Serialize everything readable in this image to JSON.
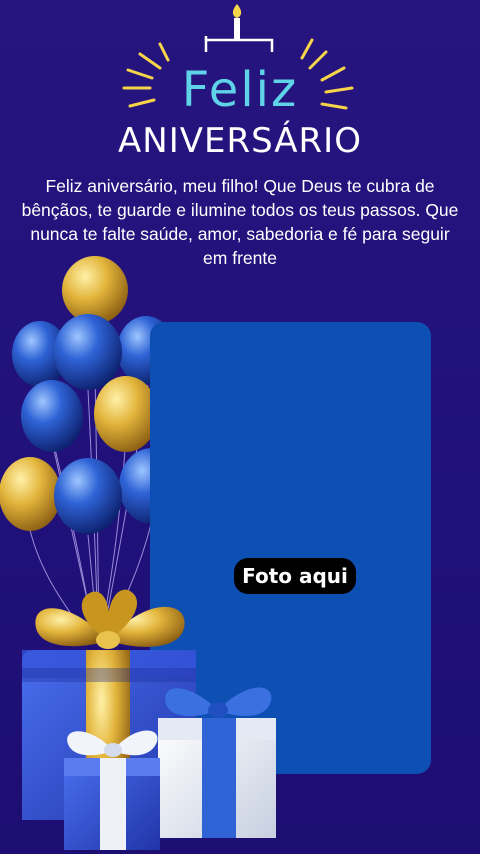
{
  "title": {
    "line1": "Feliz",
    "line2": "ANIVERSÁRIO"
  },
  "message": "Feliz aniversário, meu filho! Que Deus te cubra de bênçãos, te guarde e ilumine todos os teus passos. Que nunca te falte saúde, amor, sabedoria e fé para seguir em frente",
  "photo_placeholder": {
    "label": "Foto aqui"
  },
  "decorations": {
    "candle": "birthday-candle-icon",
    "sparkles": "sparkle-rays",
    "balloons": "balloon-bouquet-gold-blue",
    "gifts": "gift-boxes-gold-blue-white"
  },
  "colors": {
    "background": "#23127a",
    "photo_frame": "#0d4fb2",
    "title_accent": "#5fd3e8",
    "sparkle": "#f6d54a",
    "gold": "#d9a92a",
    "blue": "#1e4fc0"
  }
}
